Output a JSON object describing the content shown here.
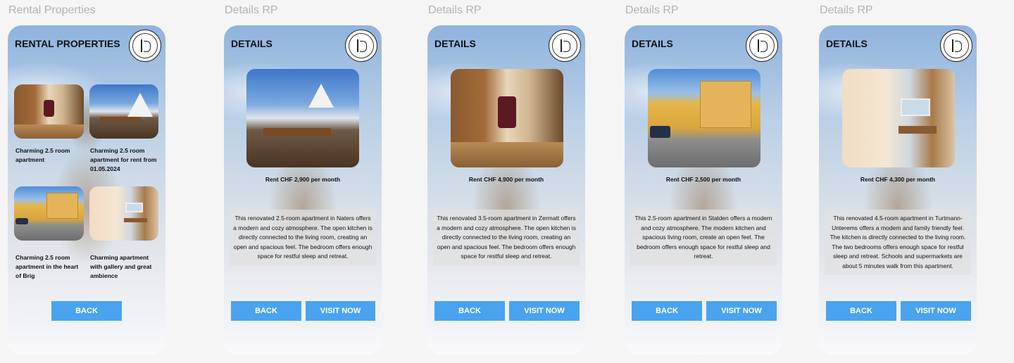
{
  "frames": [
    {
      "label": "Rental Properties",
      "title": "RENTAL PROPERTIES",
      "cards": [
        {
          "caption": "Charming 2.5 room apartment",
          "photo": "interior"
        },
        {
          "caption": "Charming 2.5 room apartment for rent from 01.05.2024",
          "photo": "mountain"
        },
        {
          "caption": "Charming 2.5 room apartment in the heart of Brig",
          "photo": "street"
        },
        {
          "caption": "Charming apartment with gallery and great ambience",
          "photo": "kitchen"
        }
      ],
      "back_label": "BACK"
    },
    {
      "label": "Details RP",
      "title": "DETAILS",
      "photo": "mountain",
      "rent": "Rent CHF 2,900 per month",
      "description": "This renovated 2.5-room apartment in Naters offers a modern and cozy atmosphere. The open kitchen is directly connected to the living room, creating an open and spacious feel. The bedroom offers enough space for restful sleep and retreat.",
      "back_label": "BACK",
      "visit_label": "VISIT NOW"
    },
    {
      "label": "Details RP",
      "title": "DETAILS",
      "photo": "interior",
      "rent": "Rent CHF 4,900 per month",
      "description": "This renovated 3.5-room apartment in Zermatt offers a modern and cozy atmosphere. The open kitchen is directly connected to the living room, creating an open and spacious feel. The bedroom offers enough  space for restful sleep and retreat.",
      "back_label": "BACK",
      "visit_label": "VISIT NOW"
    },
    {
      "label": "Details RP",
      "title": "DETAILS",
      "photo": "street",
      "rent": "Rent CHF 2,500 per month",
      "description": "This 2.5-room apartment in Stalden offers a modern and cozy atmosphere. The modern kitchen and spacious living room, create an open feel. The bedroom offers enough space for restful sleep and retreat.",
      "back_label": "BACK",
      "visit_label": "VISIT NOW"
    },
    {
      "label": "Details RP",
      "title": "DETAILS",
      "photo": "kitchen",
      "rent": "Rent CHF 4,300 per month",
      "description": "This renovated 4.5-room apartment in Turtmann-Unterems offers a modern and family friendly feel. The kitchen is directly connected to the living room. The two bedrooms offers enough space for restful sleep and retreat. Schools and supermarkets are about 5 minutes walk from this apartment.",
      "back_label": "BACK",
      "visit_label": "VISIT NOW"
    }
  ],
  "colors": {
    "button": "#4aa3ee",
    "frame_label": "#b3b3b3",
    "background": "#f5f5f5"
  }
}
